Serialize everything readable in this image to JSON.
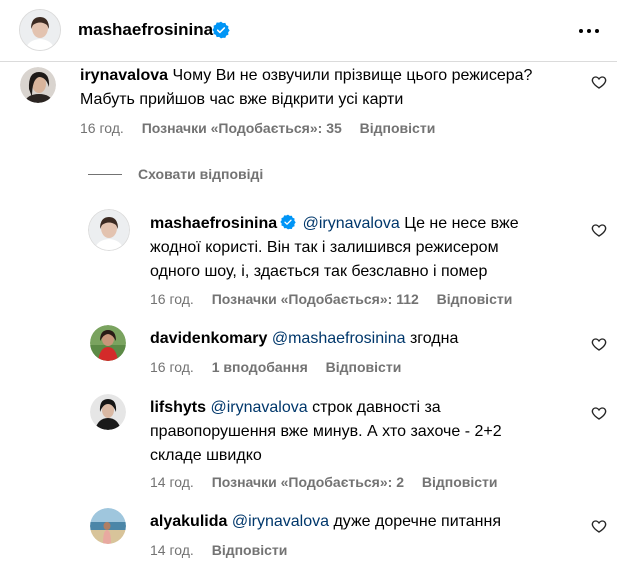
{
  "header": {
    "username": "mashaefrosinina"
  },
  "comments": [
    {
      "username": "irynavalova",
      "text": "Чому Ви не озвучили прізвище цього режисера? Мабуть прийшов час вже відкрити усі карти",
      "time": "16 год.",
      "likes": "Позначки «Подобається»: 35",
      "reply": "Відповісти"
    }
  ],
  "hide_replies": "Сховати відповіді",
  "replies": [
    {
      "username": "mashaefrosinina",
      "verified": true,
      "mention": "@irynavalova",
      "line1": "Це не несе вже",
      "line2": "жодної користі. Він так і залишився режисером",
      "line3": "одного шоу, і, здається так безславно і помер",
      "time": "16 год.",
      "likes": "Позначки «Подобається»: 112",
      "reply": "Відповісти"
    },
    {
      "username": "davidenkomary",
      "mention": "@mashaefrosinina",
      "line1": "згодна",
      "time": "16 год.",
      "likes": "1 вподобання",
      "reply": "Відповісти"
    },
    {
      "username": "lifshyts",
      "mention": "@irynavalova",
      "line1": "строк давності за",
      "line2": "правопорушення вже минув. А хто захоче - 2+2",
      "line3": "складе швидко",
      "time": "14 год.",
      "likes": "Позначки «Подобається»: 2",
      "reply": "Відповісти"
    },
    {
      "username": "alyakulida",
      "mention": "@irynavalova",
      "line1": "дуже доречне питання",
      "time": "14 год.",
      "reply": "Відповісти"
    }
  ],
  "colors": {
    "muted": "#737373",
    "mention": "#00376b",
    "verified": "#0095f6"
  },
  "icons": [
    "verified-icon",
    "more-options-icon",
    "heart-icon"
  ]
}
